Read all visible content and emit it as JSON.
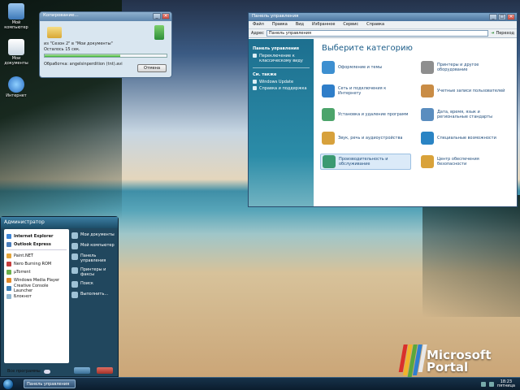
{
  "desktop": {
    "icons": [
      {
        "label": "Мой компьютер",
        "icon": "computer-icon",
        "color": "#6aa3d8"
      },
      {
        "label": "Мои документы",
        "icon": "documents-icon",
        "color": "#dfe8f0"
      },
      {
        "label": "Интернет",
        "icon": "internet-explorer-icon",
        "color": "#3b84d6"
      }
    ]
  },
  "copy_dialog": {
    "title": "Копирование...",
    "line1": "из \"Сезон 2\" в \"Мои документы\"",
    "line2": "Осталось 15 сек.",
    "progress": 0.62,
    "status": "Обработка: angelsinperdition (tnt).avi",
    "cancel_label": "Отмена"
  },
  "control_panel": {
    "title": "Панель управления",
    "menu": [
      "Файл",
      "Правка",
      "Вид",
      "Избранное",
      "Сервис",
      "Справка"
    ],
    "address_label": "Адрес",
    "address_value": "Панель управления",
    "go_label": "Переход",
    "sidebar": {
      "header1": "Панель управления",
      "switch_view": "Переключение к классическому виду",
      "header2": "См. также",
      "links": [
        "Windows Update",
        "Справка и поддержка"
      ]
    },
    "heading": "Выберите категорию",
    "categories": [
      {
        "label": "Оформление и темы",
        "icon": "appearance-icon",
        "color": "#3d8fd0"
      },
      {
        "label": "Принтеры и другое оборудование",
        "icon": "printer-icon",
        "color": "#8e8e8e"
      },
      {
        "label": "Сеть и подключения к Интернету",
        "icon": "network-icon",
        "color": "#2f7ec9"
      },
      {
        "label": "Учетные записи пользователей",
        "icon": "users-icon",
        "color": "#c98c45"
      },
      {
        "label": "Установка и удаление программ",
        "icon": "programs-icon",
        "color": "#4ca46b"
      },
      {
        "label": "Дата, время, язык и региональные стандарты",
        "icon": "datetime-icon",
        "color": "#5a8dbf"
      },
      {
        "label": "Звук, речь и аудиоустройства",
        "icon": "sound-icon",
        "color": "#d7a13c"
      },
      {
        "label": "Специальные возможности",
        "icon": "accessibility-icon",
        "color": "#2a84c4"
      },
      {
        "label": "Производительность и обслуживание",
        "icon": "performance-icon",
        "color": "#3b9a72"
      },
      {
        "label": "Центр обеспечения безопасности",
        "icon": "security-shield-icon",
        "color": "#d9a23a"
      }
    ]
  },
  "start_menu": {
    "user": "Администратор",
    "pinned": [
      {
        "label": "Internet Explorer",
        "color": "#3b84d6"
      },
      {
        "label": "Outlook Express",
        "color": "#4a7ebc"
      }
    ],
    "recent": [
      {
        "label": "Paint.NET",
        "color": "#e2a53b"
      },
      {
        "label": "Nero Burning ROM",
        "color": "#c43d3d"
      },
      {
        "label": "µTorrent",
        "color": "#6ab04c"
      },
      {
        "label": "Windows Media Player",
        "color": "#e08a2b"
      },
      {
        "label": "Creative Console Launcher",
        "color": "#3a7fb8"
      },
      {
        "label": "Блокнот",
        "color": "#8fb6d1"
      }
    ],
    "all_programs": "Все программы",
    "right": [
      "Мои документы",
      "Мой компьютер",
      "Панель управления",
      "Принтеры и факсы",
      "Поиск",
      "Выполнить..."
    ]
  },
  "taskbar": {
    "task_label": "Панель управления",
    "time": "18:23",
    "day": "пятница"
  },
  "watermark": {
    "line1": "Microsoft",
    "line2": "Portal",
    "stripe_colors": [
      "#d9302c",
      "#f1b42a",
      "#5aa83c",
      "#2f7fd0",
      "#e8e8e8"
    ]
  }
}
